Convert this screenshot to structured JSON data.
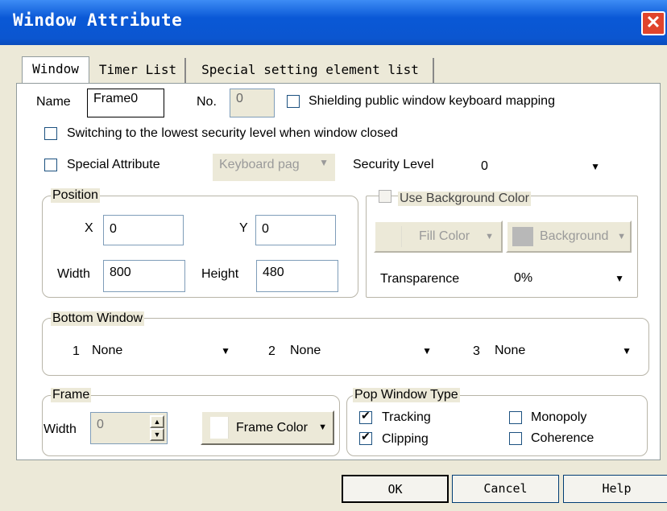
{
  "window": {
    "title": "Window Attribute",
    "close_glyph": "✕"
  },
  "tabs": [
    {
      "label": "Window",
      "active": true
    },
    {
      "label": "Timer List",
      "active": false
    },
    {
      "label": "Special setting element list",
      "active": false
    }
  ],
  "name": {
    "label": "Name",
    "value": "Frame0"
  },
  "no": {
    "label": "No.",
    "value": "0"
  },
  "shielding": {
    "label": "Shielding public window keyboard mapping",
    "checked": false
  },
  "switching": {
    "label": "Switching to the lowest security level when window closed",
    "checked": false
  },
  "special_attribute": {
    "label": "Special Attribute",
    "checked": false,
    "combo": "Keyboard pag"
  },
  "security": {
    "label": "Security Level",
    "value": "0"
  },
  "position": {
    "title": "Position",
    "x_label": "X",
    "x_value": "0",
    "y_label": "Y",
    "y_value": "0",
    "width_label": "Width",
    "width_value": "800",
    "height_label": "Height",
    "height_value": "480"
  },
  "background": {
    "use_label": "Use Background Color",
    "fill_color_label": "Fill Color",
    "background_label": "Background",
    "transparence_label": "Transparence",
    "transparence_value": "0%"
  },
  "bottom_window": {
    "title": "Bottom Window",
    "slots": [
      {
        "num": "1",
        "value": "None"
      },
      {
        "num": "2",
        "value": "None"
      },
      {
        "num": "3",
        "value": "None"
      }
    ]
  },
  "frame": {
    "title": "Frame",
    "width_label": "Width",
    "width_value": "0",
    "color_label": "Frame Color"
  },
  "pop_window": {
    "title": "Pop Window Type",
    "tracking": {
      "label": "Tracking",
      "checked": true
    },
    "clipping": {
      "label": "Clipping",
      "checked": true
    },
    "monopoly": {
      "label": "Monopoly",
      "checked": false
    },
    "coherence": {
      "label": "Coherence",
      "checked": false
    }
  },
  "buttons": {
    "ok": "OK",
    "cancel": "Cancel",
    "help": "Help"
  },
  "icons": {
    "dropdown": "chevron-down-icon",
    "close": "close-icon"
  }
}
